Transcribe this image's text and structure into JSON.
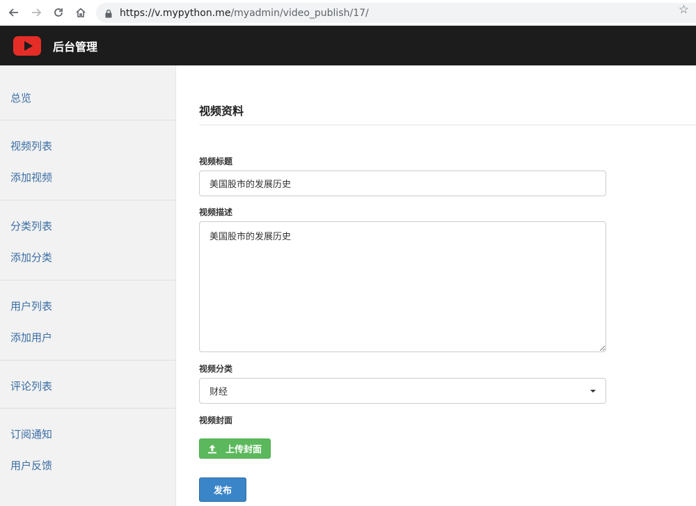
{
  "browser": {
    "url_host": "https://v.mypython.me",
    "url_path": "/myadmin/video_publish/17/"
  },
  "header": {
    "title": "后台管理"
  },
  "sidebar": {
    "items": [
      {
        "label": "总览"
      },
      {
        "label": "视频列表"
      },
      {
        "label": "添加视频"
      },
      {
        "label": "分类列表"
      },
      {
        "label": "添加分类"
      },
      {
        "label": "用户列表"
      },
      {
        "label": "添加用户"
      },
      {
        "label": "评论列表"
      },
      {
        "label": "订阅通知"
      },
      {
        "label": "用户反馈"
      }
    ]
  },
  "main": {
    "section_title": "视频资料",
    "title_label": "视频标题",
    "title_value": "美国股市的发展历史",
    "desc_label": "视频描述",
    "desc_value": "美国股市的发展历史",
    "category_label": "视频分类",
    "category_value": "财经",
    "cover_label": "视频封面",
    "upload_label": "上传封面",
    "publish_label": "发布"
  },
  "colors": {
    "header_bg": "#1c1c1c",
    "logo_red": "#e52d27",
    "sidebar_bg": "#f2f2f2",
    "link_blue": "#3a6ea5",
    "success_green": "#5cb85c",
    "primary_blue": "#3a85c8"
  },
  "icons": {
    "back": "arrow-left-icon",
    "forward": "arrow-right-icon",
    "reload": "reload-icon",
    "home": "home-icon",
    "lock": "lock-icon",
    "bookmark": "star-icon",
    "logo": "play-logo-icon",
    "upload": "upload-icon",
    "select": "caret-down-icon"
  }
}
